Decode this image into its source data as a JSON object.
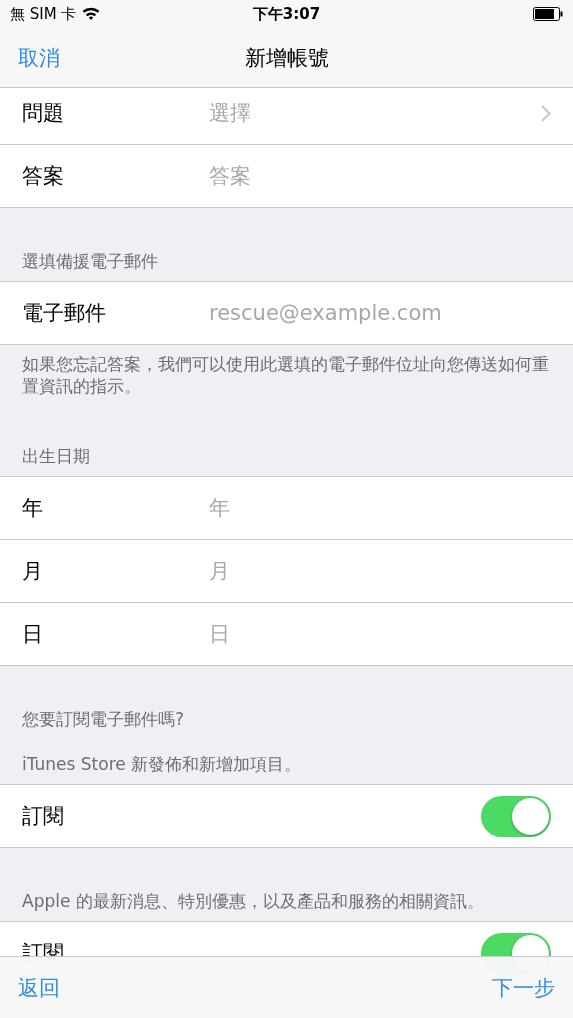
{
  "status_bar": {
    "carrier": "無 SIM 卡",
    "time": "下午3:07"
  },
  "nav": {
    "cancel": "取消",
    "title": "新增帳號"
  },
  "sections": [
    {
      "rows": [
        {
          "kind": "picker",
          "label": "問題",
          "placeholder": "選擇"
        },
        {
          "kind": "text",
          "label": "答案",
          "placeholder": "答案"
        }
      ]
    },
    {
      "headers": [
        "選填備援電子郵件"
      ],
      "rows": [
        {
          "kind": "text",
          "label": "電子郵件",
          "placeholder": "rescue@example.com"
        }
      ],
      "footer": "如果您忘記答案，我們可以使用此選填的電子郵件位址向您傳送如何重置資訊的指示。"
    },
    {
      "headers": [
        "出生日期"
      ],
      "rows": [
        {
          "kind": "text",
          "label": "年",
          "placeholder": "年"
        },
        {
          "kind": "text",
          "label": "月",
          "placeholder": "月"
        },
        {
          "kind": "text",
          "label": "日",
          "placeholder": "日"
        }
      ]
    },
    {
      "headers": [
        "您要訂閱電子郵件嗎?",
        "iTunes Store 新發佈和新增加項目。"
      ],
      "rows": [
        {
          "kind": "toggle",
          "label": "訂閱",
          "on": true
        }
      ]
    },
    {
      "headers": [
        "Apple 的最新消息、特別優惠，以及產品和服務的相關資訊。"
      ],
      "rows": [
        {
          "kind": "toggle",
          "label": "訂閱",
          "on": true
        }
      ]
    }
  ],
  "toolbar": {
    "back": "返回",
    "next": "下一步"
  }
}
